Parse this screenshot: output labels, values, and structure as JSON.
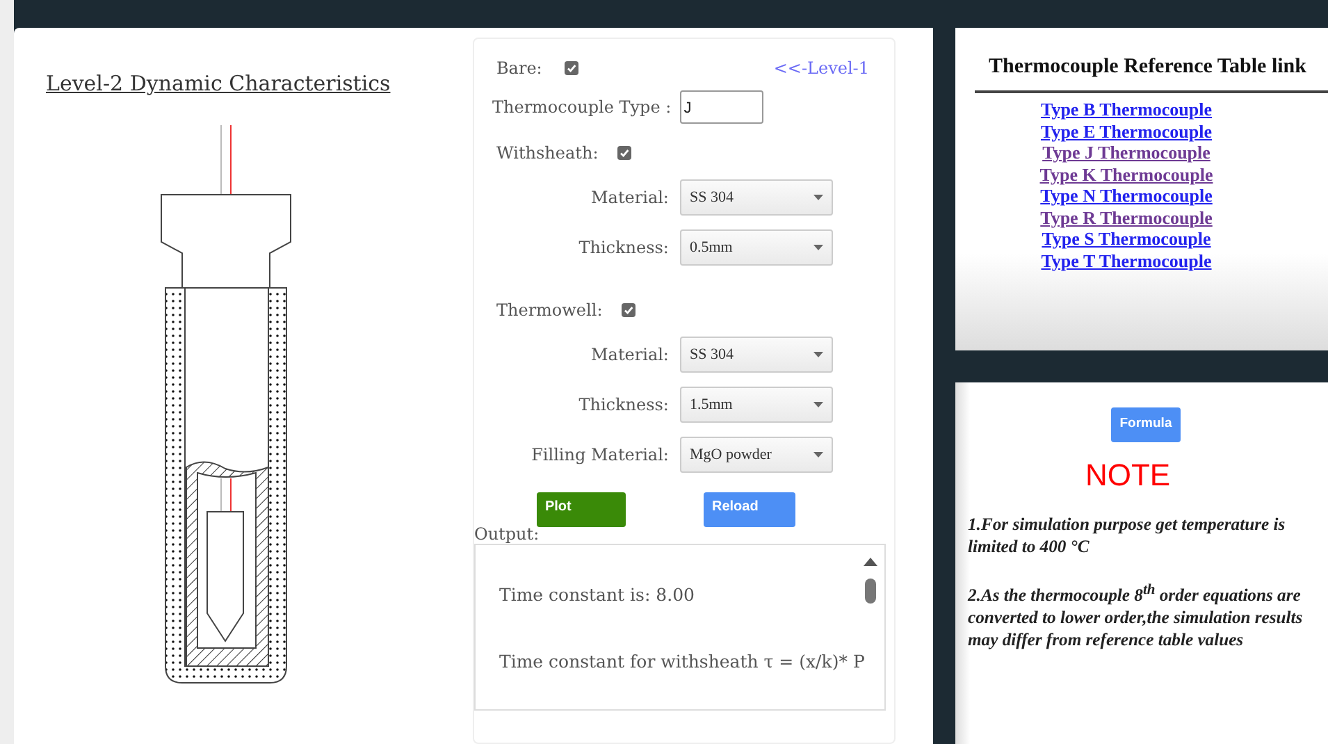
{
  "page_title": "Level-2 Dynamic Characteristics",
  "form": {
    "bare": {
      "label": "Bare:",
      "checked": true
    },
    "back_link": "<<-Level-1",
    "thermocouple_type": {
      "label": "Thermocouple Type :",
      "value": "J"
    },
    "sections": [
      {
        "label": "Withsheath:",
        "checked": true,
        "fields": [
          {
            "label": "Material:",
            "value": "SS 304"
          },
          {
            "label": "Thickness:",
            "value": "0.5mm"
          }
        ]
      },
      {
        "label": "Thermowell:",
        "checked": true,
        "fields": [
          {
            "label": "Material:",
            "value": "SS 304"
          },
          {
            "label": "Thickness:",
            "value": "1.5mm"
          },
          {
            "label": "Filling Material:",
            "value": "MgO powder"
          }
        ]
      }
    ],
    "buttons": [
      {
        "label": "Plot",
        "kind": "success"
      },
      {
        "label": "Reload",
        "kind": "primary"
      }
    ],
    "output": {
      "label": "Output:",
      "lines": [
        "Time constant is: 8.00",
        "Time constant for withsheath τ = (x/k)* P"
      ]
    }
  },
  "reference_table": {
    "title": "Thermocouple Reference Table link",
    "links": [
      {
        "label": "Type B Thermocouple",
        "visited": false
      },
      {
        "label": "Type E Thermocouple",
        "visited": false
      },
      {
        "label": "Type J Thermocouple",
        "visited": true
      },
      {
        "label": "Type K Thermocouple",
        "visited": true
      },
      {
        "label": "Type N Thermocouple",
        "visited": false
      },
      {
        "label": "Type R Thermocouple",
        "visited": true
      },
      {
        "label": "Type S Thermocouple",
        "visited": false
      },
      {
        "label": "Type T Thermocouple",
        "visited": false
      }
    ]
  },
  "note_panel": {
    "button": "Formula",
    "heading": "NOTE",
    "notes": [
      "1.For simulation purpose get temperature is limited to 400 °C",
      "2.As the thermocouple 8$^{th}$ order equations are converted to lower order,the simulation results may differ from reference table values"
    ]
  }
}
